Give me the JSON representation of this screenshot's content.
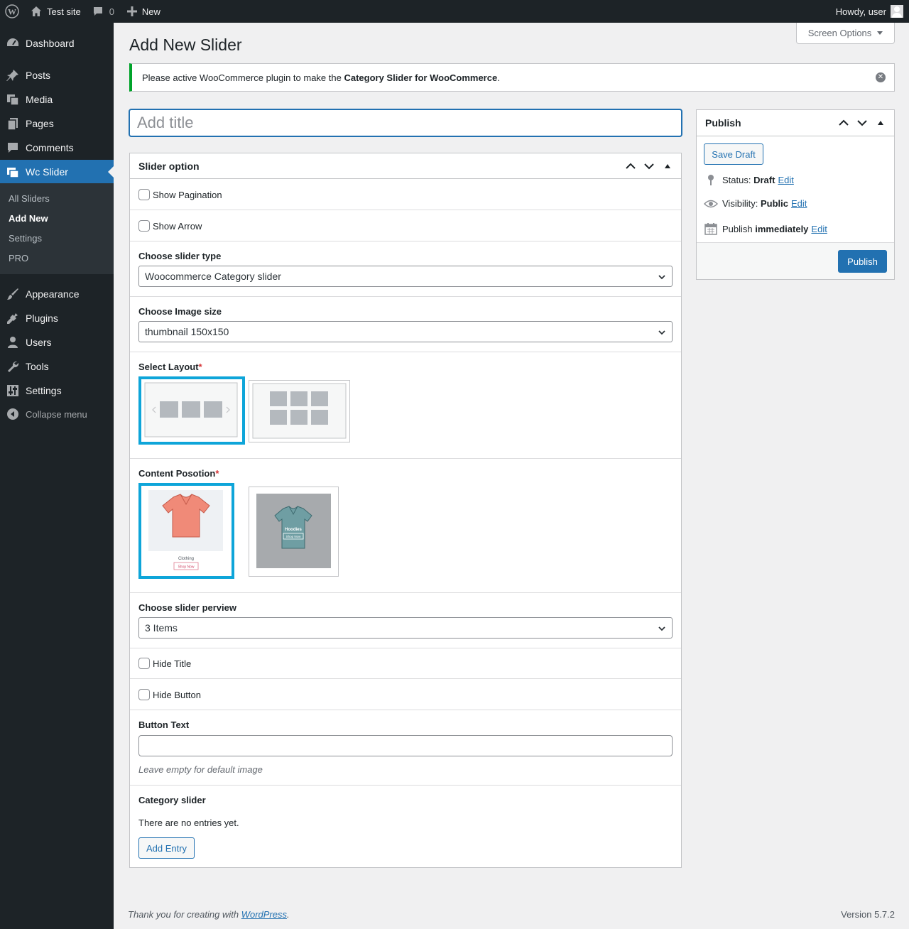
{
  "admin_bar": {
    "site_name": "Test site",
    "comments_count": "0",
    "new_label": "New",
    "greeting": "Howdy, user"
  },
  "sidebar": {
    "items": [
      {
        "label": "Dashboard",
        "icon": "dashboard-icon"
      },
      {
        "label": "Posts",
        "icon": "pin-icon"
      },
      {
        "label": "Media",
        "icon": "media-icon"
      },
      {
        "label": "Pages",
        "icon": "pages-icon"
      },
      {
        "label": "Comments",
        "icon": "comment-icon"
      },
      {
        "label": "Wc Slider",
        "icon": "slider-icon"
      },
      {
        "label": "Appearance",
        "icon": "brush-icon"
      },
      {
        "label": "Plugins",
        "icon": "plug-icon"
      },
      {
        "label": "Users",
        "icon": "user-icon"
      },
      {
        "label": "Tools",
        "icon": "wrench-icon"
      },
      {
        "label": "Settings",
        "icon": "settings-sliders-icon"
      }
    ],
    "submenu": [
      "All Sliders",
      "Add New",
      "Settings",
      "PRO"
    ],
    "collapse_label": "Collapse menu"
  },
  "page": {
    "title": "Add New Slider",
    "screen_options": "Screen Options",
    "notice_prefix": "Please active WooCommerce plugin to make the ",
    "notice_strong": "Category Slider for WooCommerce",
    "notice_suffix": ".",
    "title_placeholder": "Add title"
  },
  "slider_option": {
    "heading": "Slider option",
    "show_pagination": "Show Pagination",
    "show_arrow": "Show Arrow",
    "slider_type_label": "Choose slider type",
    "slider_type_value": "Woocommerce Category slider",
    "image_size_label": "Choose Image size",
    "image_size_value": "thumbnail 150x150",
    "layout_label": "Select Layout",
    "content_position_label": "Content Posotion",
    "required_mark": "*",
    "perview_label": "Choose slider perview",
    "perview_value": "3 Items",
    "hide_title": "Hide Title",
    "hide_button": "Hide Button",
    "button_text_label": "Button Text",
    "button_text_value": "",
    "button_text_desc": "Leave empty for default image",
    "category_slider_label": "Category slider",
    "no_entries": "There are no entries yet.",
    "add_entry": "Add Entry",
    "preview_thumbs": {
      "thumb1_caption": "Clothing",
      "thumb1_button": "Shop Now",
      "thumb2_caption": "Hoodies",
      "thumb2_button": "Shop Now"
    }
  },
  "publish": {
    "heading": "Publish",
    "save_draft": "Save Draft",
    "status_label": "Status:",
    "status_value": "Draft",
    "visibility_label": "Visibility:",
    "visibility_value": "Public",
    "publish_label": "Publish",
    "publish_value": "immediately",
    "edit": "Edit",
    "publish_button": "Publish"
  },
  "footer": {
    "thanks_prefix": "Thank you for creating with ",
    "thanks_link": "WordPress",
    "thanks_suffix": ".",
    "version": "Version 5.7.2"
  },
  "colors": {
    "accent": "#2271b1",
    "selected_border": "#0ea5d9",
    "notice_success": "#00a32a",
    "sidebar_bg": "#1d2327"
  }
}
